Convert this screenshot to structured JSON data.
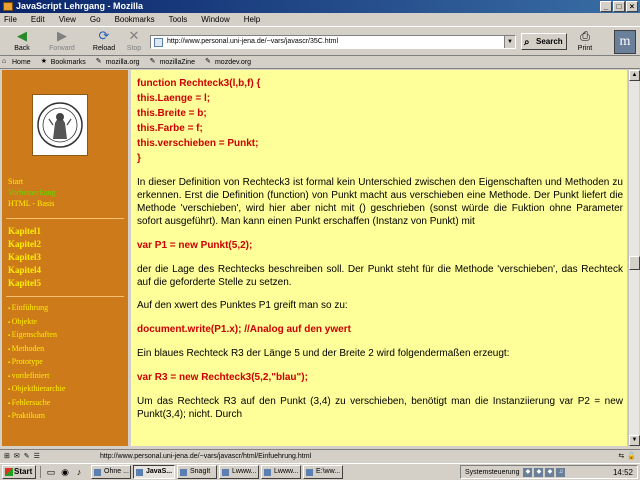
{
  "window": {
    "title": "JavaScript Lehrgang - Mozilla",
    "controls": [
      "_",
      "□",
      "×"
    ]
  },
  "menu": [
    "File",
    "Edit",
    "View",
    "Go",
    "Bookmarks",
    "Tools",
    "Window",
    "Help"
  ],
  "nav": {
    "back": "Back",
    "forward": "Forward",
    "reload": "Reload",
    "stop": "Stop",
    "url": "http://www.personal.uni-jena.de/~vars/javascr/35C.html",
    "search": "Search",
    "print": "Print",
    "brand": "m"
  },
  "personal_bar": [
    "Home",
    "Bookmarks",
    "mozilla.org",
    "mozillaZine",
    "mozdev.org"
  ],
  "sidebar": {
    "group1": [
      "Start",
      "Vorbemerkung",
      "HTML - Basis"
    ],
    "group2": [
      "Kapitel1",
      "Kapitel2",
      "Kapitel3",
      "Kapitel4",
      "Kapitel5"
    ],
    "group3": [
      "Einführung",
      "Objekte",
      "Eigenschaften",
      "Methoden",
      "Prototype",
      "vordefiniert",
      "Objekthierarchie",
      "Fehlersuche",
      "Praktikum"
    ]
  },
  "content": {
    "code1": [
      "function Rechteck3(l,b,f) {",
      "this.Laenge = l;",
      "this.Breite = b;",
      "this.Farbe = f;",
      "this.verschieben = Punkt;",
      "}"
    ],
    "p1": "In dieser Definition von Rechteck3 ist formal kein Unterschied zwischen den Eigenschaften und Methoden zu erkennen. Erst die Definition (function) von Punkt macht aus verschieben eine Methode. Der Punkt liefert die Methode 'verschieben', wird hier aber nicht mit () geschrieben (sonst würde die Fuktion ohne Parameter sofort ausgeführt). Man kann einen Punkt erschaffen (Instanz von Punkt) mit",
    "code2": "var P1 = new Punkt(5,2);",
    "p2": "der die Lage des Rechtecks beschreiben soll. Der Punkt steht für die Methode 'verschieben', das Rechteck auf die geforderte Stelle zu setzen.",
    "p3": "Auf den xwert des Punktes P1 greift man so zu:",
    "code3": "document.write(P1.x); //Analog auf den ywert",
    "p4": "Ein blaues Rechteck R3 der Länge 5 und der Breite 2 wird folgendermaßen erzeugt:",
    "code4": "var R3 = new Rechteck3(5,2,\"blau\");",
    "p5": "Um das Rechteck R3 auf den Punkt (3,4) zu verschieben, benötigt man die Instanziierung var P2 = new Punkt(3,4); nicht. Durch"
  },
  "status": {
    "url": "http://www.personal.uni-jena.de/~vars/javascr/html/Einfuehrung.html"
  },
  "taskbar": {
    "start": "Start",
    "tasks": [
      "Ohne ...",
      "JavaS...",
      "SnagIt",
      "Lwww...",
      "Lwww...",
      "E:\\ww..."
    ],
    "tray_label": "Systemsteuerung",
    "clock": "14:52"
  }
}
